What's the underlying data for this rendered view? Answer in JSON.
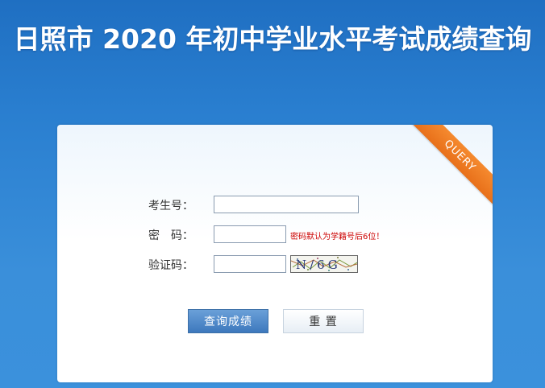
{
  "header": {
    "title": "日照市 2020 年初中学业水平考试成绩查询"
  },
  "panel": {
    "ribbon_text": "QUERY"
  },
  "form": {
    "exam_id_label": "考生号：",
    "password_label": "密　码：",
    "password_hint": "密码默认为学籍号后6位！",
    "captcha_label": "验证码：",
    "captcha_text": "N/6G",
    "exam_id_value": "",
    "password_value": "",
    "captcha_value": ""
  },
  "buttons": {
    "query_label": "查询成绩",
    "reset_label": "重 置"
  },
  "colors": {
    "background": "#2a7fd0",
    "ribbon": "#f07a22",
    "primary_button": "#4a86c8",
    "hint": "#cc0000"
  }
}
